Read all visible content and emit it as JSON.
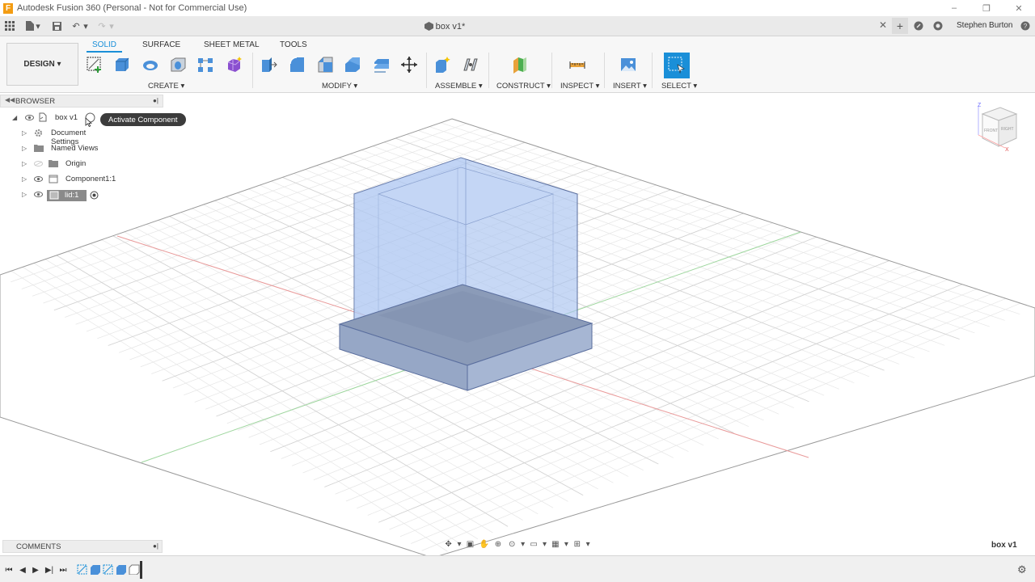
{
  "window": {
    "title": "Autodesk Fusion 360 (Personal - Not for Commercial Use)",
    "logo_letter": "F",
    "controls": [
      "–",
      "❐",
      "✕"
    ]
  },
  "tabs": {
    "document_tab": "box v1*",
    "user_name": "Stephen Burton"
  },
  "ribbon": {
    "workspace": "DESIGN ▾",
    "tabs": [
      "SOLID",
      "SURFACE",
      "SHEET METAL",
      "TOOLS"
    ],
    "active_tab": "SOLID",
    "groups": [
      "CREATE ▾",
      "MODIFY ▾",
      "ASSEMBLE ▾",
      "CONSTRUCT ▾",
      "INSPECT ▾",
      "INSERT ▾",
      "SELECT ▾"
    ]
  },
  "browser": {
    "title": "BROWSER",
    "items": [
      {
        "label": "box v1",
        "icon": "document-icon"
      },
      {
        "label": "Document Settings",
        "icon": "gear-icon"
      },
      {
        "label": "Named Views",
        "icon": "folder-icon"
      },
      {
        "label": "Origin",
        "icon": "folder-icon"
      },
      {
        "label": "Component1:1",
        "icon": "component-icon"
      },
      {
        "label": "lid:1",
        "icon": "component-icon"
      }
    ],
    "tooltip": "Activate Component"
  },
  "comments": {
    "title": "COMMENTS"
  },
  "viewcube": {
    "front": "FRONT",
    "right": "RIGHT",
    "axis_z": "Z",
    "axis_x": "X"
  },
  "viewport": {
    "document_label": "box v1"
  },
  "colors": {
    "accent": "#1a8fd8",
    "model_fill": "#a9c3f0",
    "model_edge": "#5a6e9e",
    "base_fill": "#7d8fa6"
  }
}
